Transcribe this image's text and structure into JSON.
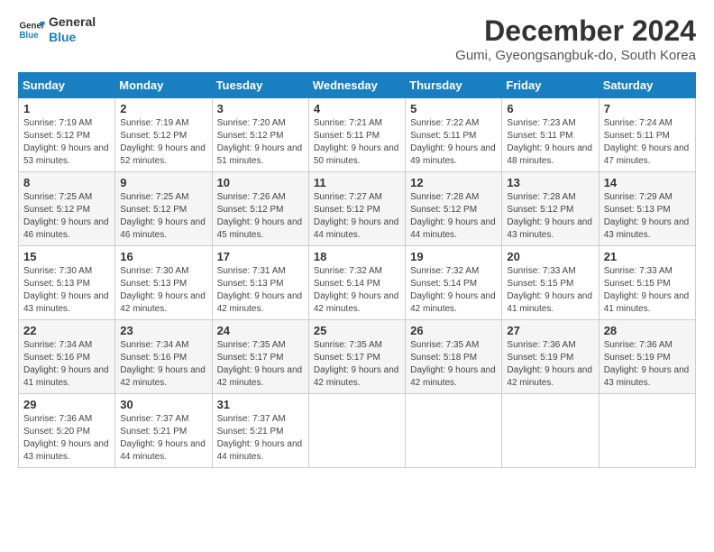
{
  "logo": {
    "line1": "General",
    "line2": "Blue"
  },
  "title": "December 2024",
  "subtitle": "Gumi, Gyeongsangbuk-do, South Korea",
  "weekdays": [
    "Sunday",
    "Monday",
    "Tuesday",
    "Wednesday",
    "Thursday",
    "Friday",
    "Saturday"
  ],
  "weeks": [
    [
      {
        "day": 1,
        "sunrise": "7:19 AM",
        "sunset": "5:12 PM",
        "daylight": "9 hours and 53 minutes."
      },
      {
        "day": 2,
        "sunrise": "7:19 AM",
        "sunset": "5:12 PM",
        "daylight": "9 hours and 52 minutes."
      },
      {
        "day": 3,
        "sunrise": "7:20 AM",
        "sunset": "5:12 PM",
        "daylight": "9 hours and 51 minutes."
      },
      {
        "day": 4,
        "sunrise": "7:21 AM",
        "sunset": "5:11 PM",
        "daylight": "9 hours and 50 minutes."
      },
      {
        "day": 5,
        "sunrise": "7:22 AM",
        "sunset": "5:11 PM",
        "daylight": "9 hours and 49 minutes."
      },
      {
        "day": 6,
        "sunrise": "7:23 AM",
        "sunset": "5:11 PM",
        "daylight": "9 hours and 48 minutes."
      },
      {
        "day": 7,
        "sunrise": "7:24 AM",
        "sunset": "5:11 PM",
        "daylight": "9 hours and 47 minutes."
      }
    ],
    [
      {
        "day": 8,
        "sunrise": "7:25 AM",
        "sunset": "5:12 PM",
        "daylight": "9 hours and 46 minutes."
      },
      {
        "day": 9,
        "sunrise": "7:25 AM",
        "sunset": "5:12 PM",
        "daylight": "9 hours and 46 minutes."
      },
      {
        "day": 10,
        "sunrise": "7:26 AM",
        "sunset": "5:12 PM",
        "daylight": "9 hours and 45 minutes."
      },
      {
        "day": 11,
        "sunrise": "7:27 AM",
        "sunset": "5:12 PM",
        "daylight": "9 hours and 44 minutes."
      },
      {
        "day": 12,
        "sunrise": "7:28 AM",
        "sunset": "5:12 PM",
        "daylight": "9 hours and 44 minutes."
      },
      {
        "day": 13,
        "sunrise": "7:28 AM",
        "sunset": "5:12 PM",
        "daylight": "9 hours and 43 minutes."
      },
      {
        "day": 14,
        "sunrise": "7:29 AM",
        "sunset": "5:13 PM",
        "daylight": "9 hours and 43 minutes."
      }
    ],
    [
      {
        "day": 15,
        "sunrise": "7:30 AM",
        "sunset": "5:13 PM",
        "daylight": "9 hours and 43 minutes."
      },
      {
        "day": 16,
        "sunrise": "7:30 AM",
        "sunset": "5:13 PM",
        "daylight": "9 hours and 42 minutes."
      },
      {
        "day": 17,
        "sunrise": "7:31 AM",
        "sunset": "5:13 PM",
        "daylight": "9 hours and 42 minutes."
      },
      {
        "day": 18,
        "sunrise": "7:32 AM",
        "sunset": "5:14 PM",
        "daylight": "9 hours and 42 minutes."
      },
      {
        "day": 19,
        "sunrise": "7:32 AM",
        "sunset": "5:14 PM",
        "daylight": "9 hours and 42 minutes."
      },
      {
        "day": 20,
        "sunrise": "7:33 AM",
        "sunset": "5:15 PM",
        "daylight": "9 hours and 41 minutes."
      },
      {
        "day": 21,
        "sunrise": "7:33 AM",
        "sunset": "5:15 PM",
        "daylight": "9 hours and 41 minutes."
      }
    ],
    [
      {
        "day": 22,
        "sunrise": "7:34 AM",
        "sunset": "5:16 PM",
        "daylight": "9 hours and 41 minutes."
      },
      {
        "day": 23,
        "sunrise": "7:34 AM",
        "sunset": "5:16 PM",
        "daylight": "9 hours and 42 minutes."
      },
      {
        "day": 24,
        "sunrise": "7:35 AM",
        "sunset": "5:17 PM",
        "daylight": "9 hours and 42 minutes."
      },
      {
        "day": 25,
        "sunrise": "7:35 AM",
        "sunset": "5:17 PM",
        "daylight": "9 hours and 42 minutes."
      },
      {
        "day": 26,
        "sunrise": "7:35 AM",
        "sunset": "5:18 PM",
        "daylight": "9 hours and 42 minutes."
      },
      {
        "day": 27,
        "sunrise": "7:36 AM",
        "sunset": "5:19 PM",
        "daylight": "9 hours and 42 minutes."
      },
      {
        "day": 28,
        "sunrise": "7:36 AM",
        "sunset": "5:19 PM",
        "daylight": "9 hours and 43 minutes."
      }
    ],
    [
      {
        "day": 29,
        "sunrise": "7:36 AM",
        "sunset": "5:20 PM",
        "daylight": "9 hours and 43 minutes."
      },
      {
        "day": 30,
        "sunrise": "7:37 AM",
        "sunset": "5:21 PM",
        "daylight": "9 hours and 44 minutes."
      },
      {
        "day": 31,
        "sunrise": "7:37 AM",
        "sunset": "5:21 PM",
        "daylight": "9 hours and 44 minutes."
      },
      null,
      null,
      null,
      null
    ]
  ]
}
